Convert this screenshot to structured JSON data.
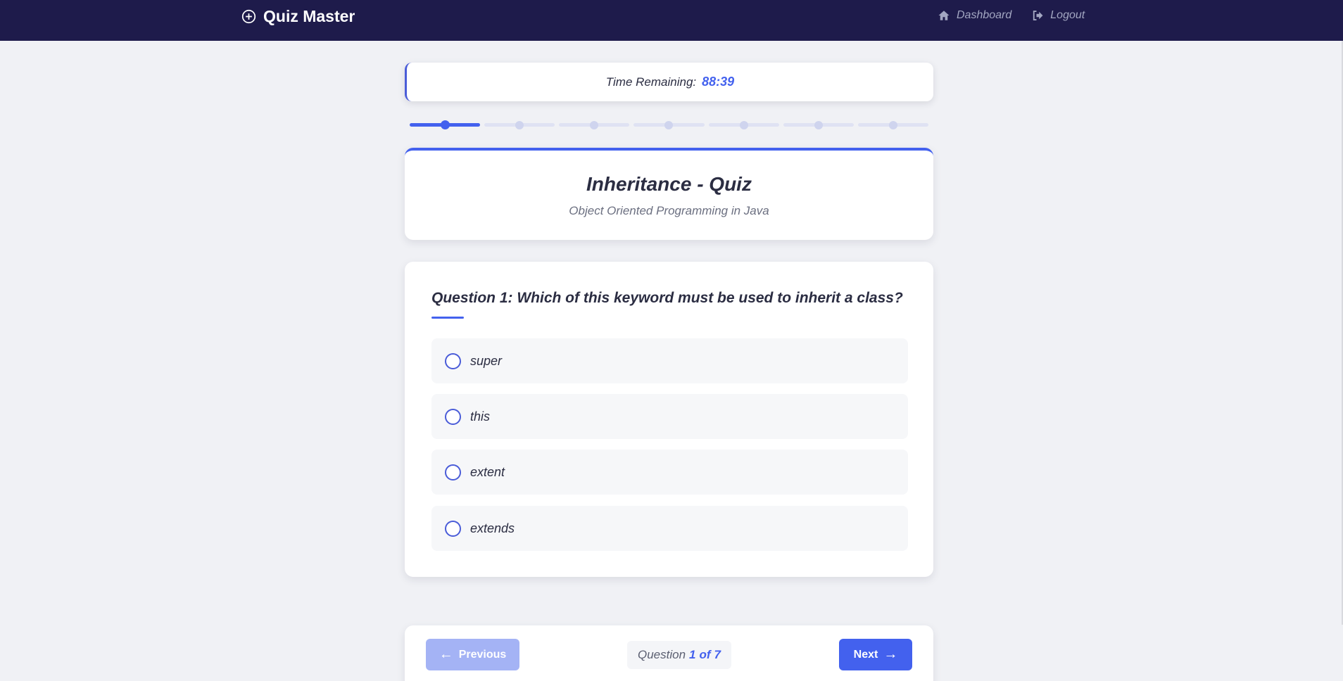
{
  "nav": {
    "brand": "Quiz Master",
    "brand_icon": "plus-circle-icon",
    "links": [
      {
        "label": "Dashboard",
        "icon": "home-icon"
      },
      {
        "label": "Logout",
        "icon": "logout-icon"
      }
    ]
  },
  "timer": {
    "label": "Time Remaining:",
    "value": "88:39"
  },
  "progress": {
    "total": 7,
    "current": 1
  },
  "quiz": {
    "title": "Inheritance - Quiz",
    "subtitle": "Object Oriented Programming in Java"
  },
  "question": {
    "text": "Question 1: Which of this keyword must be used to inherit a class?",
    "options": [
      "super",
      "this",
      "extent",
      "extends"
    ]
  },
  "footer": {
    "prev_label": "Previous",
    "next_label": "Next",
    "counter_prefix": "Question",
    "counter_current": "1",
    "counter_sep": "of",
    "counter_total": "7"
  },
  "colors": {
    "navbar": "#1e1b4b",
    "accent": "#4361ee",
    "prev_disabled": "#a4b3f5",
    "background": "#f0f1f5"
  }
}
